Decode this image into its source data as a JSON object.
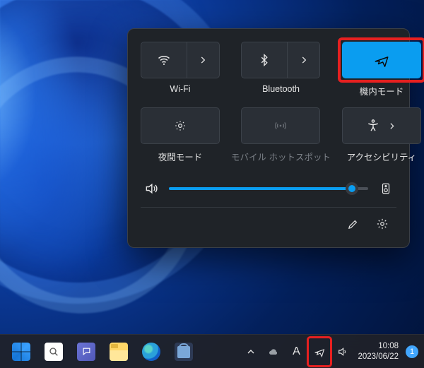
{
  "quick_settings": {
    "tiles": [
      {
        "key": "wifi",
        "label": "Wi-Fi",
        "icon": "wifi-icon",
        "split": true,
        "enabled": true,
        "active": false
      },
      {
        "key": "bluetooth",
        "label": "Bluetooth",
        "icon": "bluetooth-icon",
        "split": true,
        "enabled": true,
        "active": false
      },
      {
        "key": "airplane",
        "label": "機内モード",
        "icon": "airplane-icon",
        "split": false,
        "enabled": true,
        "active": true,
        "highlighted": true
      },
      {
        "key": "nightlight",
        "label": "夜間モード",
        "icon": "nightlight-icon",
        "split": false,
        "enabled": true,
        "active": false
      },
      {
        "key": "hotspot",
        "label": "モバイル ホットスポット",
        "icon": "hotspot-icon",
        "split": false,
        "enabled": false,
        "active": false
      },
      {
        "key": "accessibility",
        "label": "アクセシビリティ",
        "icon": "accessibility-icon",
        "split": true,
        "split_style": "inline",
        "enabled": true,
        "active": false
      }
    ],
    "volume": {
      "percent": 92
    },
    "footer": {
      "edit": "edit",
      "settings": "settings"
    }
  },
  "taskbar": {
    "tray": {
      "ime": "A",
      "airplane_highlighted": true
    },
    "clock": {
      "time": "10:08",
      "date": "2023/06/22"
    },
    "notifications": "1"
  }
}
